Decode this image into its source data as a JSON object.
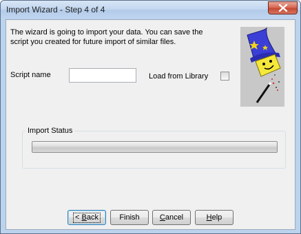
{
  "window": {
    "title": "Import Wizard - Step 4 of 4",
    "close_icon": "close-icon"
  },
  "intro_text": "The wizard is going to import your data. You can save the script you created for future import of similar files.",
  "script_name": {
    "label": "Script name",
    "value": ""
  },
  "load_from_library": {
    "label": "Load from Library",
    "checked": false
  },
  "wizard_image": {
    "icon": "wizard-icon"
  },
  "import_status": {
    "title": "Import Status",
    "progress": 0
  },
  "buttons": {
    "back": {
      "mnemonic": "B",
      "rest": "ack"
    },
    "finish": "Finish",
    "cancel": {
      "mnemonic": "C",
      "rest": "ancel"
    },
    "help": {
      "mnemonic": "H",
      "rest": "elp"
    }
  },
  "colors": {
    "titlebar": "#c2d6ef",
    "client_bg": "#f0f0f0",
    "close_button": "#c44a35"
  }
}
